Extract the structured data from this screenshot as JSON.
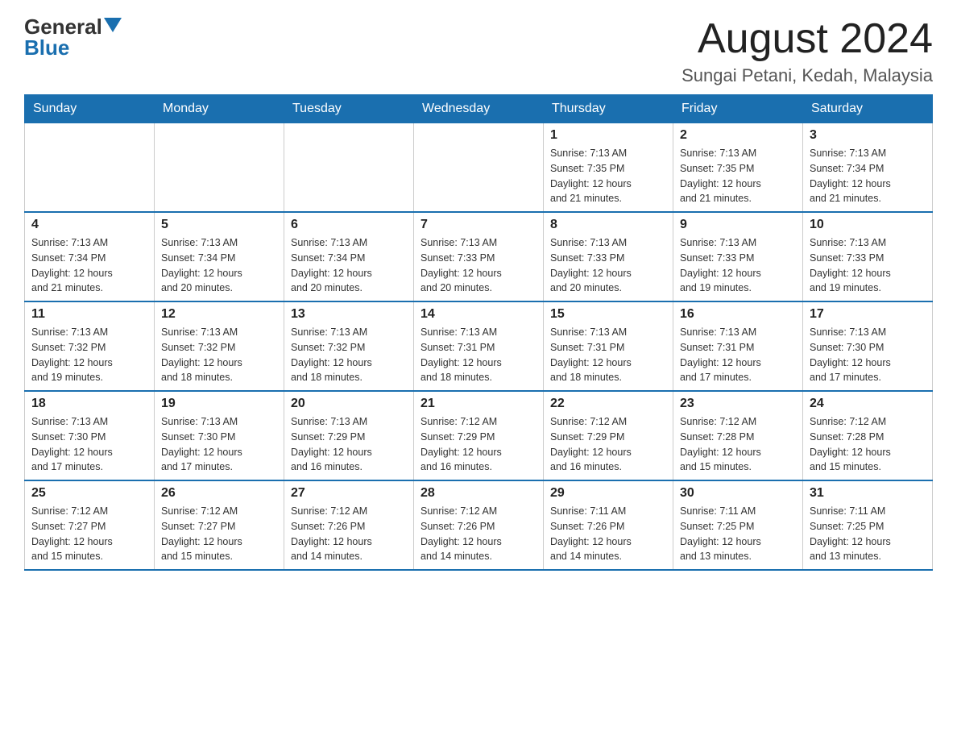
{
  "header": {
    "logo_general": "General",
    "logo_blue": "Blue",
    "month_title": "August 2024",
    "location": "Sungai Petani, Kedah, Malaysia"
  },
  "days_of_week": [
    "Sunday",
    "Monday",
    "Tuesday",
    "Wednesday",
    "Thursday",
    "Friday",
    "Saturday"
  ],
  "weeks": [
    [
      {
        "day": "",
        "info": ""
      },
      {
        "day": "",
        "info": ""
      },
      {
        "day": "",
        "info": ""
      },
      {
        "day": "",
        "info": ""
      },
      {
        "day": "1",
        "info": "Sunrise: 7:13 AM\nSunset: 7:35 PM\nDaylight: 12 hours\nand 21 minutes."
      },
      {
        "day": "2",
        "info": "Sunrise: 7:13 AM\nSunset: 7:35 PM\nDaylight: 12 hours\nand 21 minutes."
      },
      {
        "day": "3",
        "info": "Sunrise: 7:13 AM\nSunset: 7:34 PM\nDaylight: 12 hours\nand 21 minutes."
      }
    ],
    [
      {
        "day": "4",
        "info": "Sunrise: 7:13 AM\nSunset: 7:34 PM\nDaylight: 12 hours\nand 21 minutes."
      },
      {
        "day": "5",
        "info": "Sunrise: 7:13 AM\nSunset: 7:34 PM\nDaylight: 12 hours\nand 20 minutes."
      },
      {
        "day": "6",
        "info": "Sunrise: 7:13 AM\nSunset: 7:34 PM\nDaylight: 12 hours\nand 20 minutes."
      },
      {
        "day": "7",
        "info": "Sunrise: 7:13 AM\nSunset: 7:33 PM\nDaylight: 12 hours\nand 20 minutes."
      },
      {
        "day": "8",
        "info": "Sunrise: 7:13 AM\nSunset: 7:33 PM\nDaylight: 12 hours\nand 20 minutes."
      },
      {
        "day": "9",
        "info": "Sunrise: 7:13 AM\nSunset: 7:33 PM\nDaylight: 12 hours\nand 19 minutes."
      },
      {
        "day": "10",
        "info": "Sunrise: 7:13 AM\nSunset: 7:33 PM\nDaylight: 12 hours\nand 19 minutes."
      }
    ],
    [
      {
        "day": "11",
        "info": "Sunrise: 7:13 AM\nSunset: 7:32 PM\nDaylight: 12 hours\nand 19 minutes."
      },
      {
        "day": "12",
        "info": "Sunrise: 7:13 AM\nSunset: 7:32 PM\nDaylight: 12 hours\nand 18 minutes."
      },
      {
        "day": "13",
        "info": "Sunrise: 7:13 AM\nSunset: 7:32 PM\nDaylight: 12 hours\nand 18 minutes."
      },
      {
        "day": "14",
        "info": "Sunrise: 7:13 AM\nSunset: 7:31 PM\nDaylight: 12 hours\nand 18 minutes."
      },
      {
        "day": "15",
        "info": "Sunrise: 7:13 AM\nSunset: 7:31 PM\nDaylight: 12 hours\nand 18 minutes."
      },
      {
        "day": "16",
        "info": "Sunrise: 7:13 AM\nSunset: 7:31 PM\nDaylight: 12 hours\nand 17 minutes."
      },
      {
        "day": "17",
        "info": "Sunrise: 7:13 AM\nSunset: 7:30 PM\nDaylight: 12 hours\nand 17 minutes."
      }
    ],
    [
      {
        "day": "18",
        "info": "Sunrise: 7:13 AM\nSunset: 7:30 PM\nDaylight: 12 hours\nand 17 minutes."
      },
      {
        "day": "19",
        "info": "Sunrise: 7:13 AM\nSunset: 7:30 PM\nDaylight: 12 hours\nand 17 minutes."
      },
      {
        "day": "20",
        "info": "Sunrise: 7:13 AM\nSunset: 7:29 PM\nDaylight: 12 hours\nand 16 minutes."
      },
      {
        "day": "21",
        "info": "Sunrise: 7:12 AM\nSunset: 7:29 PM\nDaylight: 12 hours\nand 16 minutes."
      },
      {
        "day": "22",
        "info": "Sunrise: 7:12 AM\nSunset: 7:29 PM\nDaylight: 12 hours\nand 16 minutes."
      },
      {
        "day": "23",
        "info": "Sunrise: 7:12 AM\nSunset: 7:28 PM\nDaylight: 12 hours\nand 15 minutes."
      },
      {
        "day": "24",
        "info": "Sunrise: 7:12 AM\nSunset: 7:28 PM\nDaylight: 12 hours\nand 15 minutes."
      }
    ],
    [
      {
        "day": "25",
        "info": "Sunrise: 7:12 AM\nSunset: 7:27 PM\nDaylight: 12 hours\nand 15 minutes."
      },
      {
        "day": "26",
        "info": "Sunrise: 7:12 AM\nSunset: 7:27 PM\nDaylight: 12 hours\nand 15 minutes."
      },
      {
        "day": "27",
        "info": "Sunrise: 7:12 AM\nSunset: 7:26 PM\nDaylight: 12 hours\nand 14 minutes."
      },
      {
        "day": "28",
        "info": "Sunrise: 7:12 AM\nSunset: 7:26 PM\nDaylight: 12 hours\nand 14 minutes."
      },
      {
        "day": "29",
        "info": "Sunrise: 7:11 AM\nSunset: 7:26 PM\nDaylight: 12 hours\nand 14 minutes."
      },
      {
        "day": "30",
        "info": "Sunrise: 7:11 AM\nSunset: 7:25 PM\nDaylight: 12 hours\nand 13 minutes."
      },
      {
        "day": "31",
        "info": "Sunrise: 7:11 AM\nSunset: 7:25 PM\nDaylight: 12 hours\nand 13 minutes."
      }
    ]
  ]
}
